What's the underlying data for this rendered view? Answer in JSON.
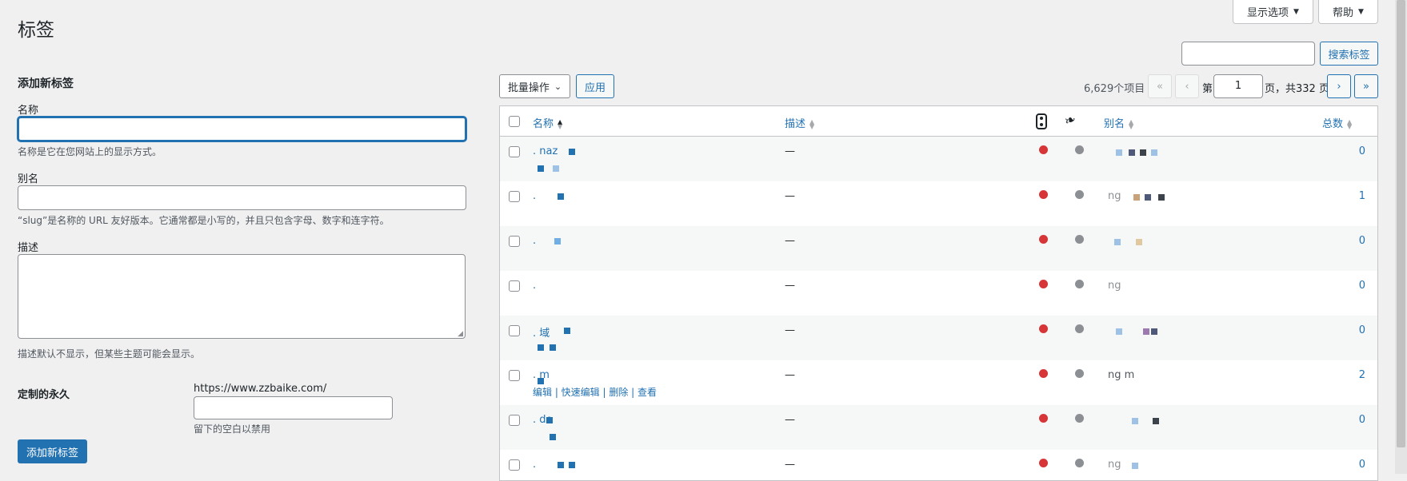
{
  "page_title": "标签",
  "screen_options_label": "显示选项",
  "help_label": "帮助",
  "search": {
    "button_label": "搜索标签",
    "value": ""
  },
  "add_form": {
    "heading": "添加新标签",
    "name_label": "名称",
    "name_value": "",
    "name_hint": "名称是它在您网站上的显示方式。",
    "slug_label": "别名",
    "slug_value": "",
    "slug_hint": "“slug”是名称的 URL 友好版本。它通常都是小写的，并且只包含字母、数字和连字符。",
    "desc_label": "描述",
    "desc_value": "",
    "desc_hint": "描述默认不显示，但某些主题可能会显示。",
    "permalink_label": "定制的永久",
    "permalink_prefix": "https://www.zzbaike.com/",
    "permalink_value": "",
    "permalink_hint": "留下的空白以禁用",
    "submit_label": "添加新标签"
  },
  "toolbar": {
    "bulk_label": "批量操作",
    "apply_label": "应用",
    "item_count": "6,629个项目",
    "first_page": "«",
    "prev_page": "‹",
    "page_prefix": "第",
    "current_page": "1",
    "page_suffix": "页，共332 页",
    "next_page": "›",
    "last_page": "»"
  },
  "table": {
    "columns": {
      "name": "名称",
      "description": "描述",
      "slug": "别名",
      "count": "总数"
    },
    "rows": [
      {
        "name": ".  naz",
        "description": "—",
        "slug": "",
        "count": "0",
        "status_color": "#d63638",
        "seo_color": "#8c8f94"
      },
      {
        "name": ".",
        "description": "—",
        "slug": "ng",
        "count": "1",
        "status_color": "#d63638",
        "seo_color": "#8c8f94"
      },
      {
        "name": ".",
        "description": "—",
        "slug": "",
        "count": "0",
        "status_color": "#d63638",
        "seo_color": "#8c8f94"
      },
      {
        "name": ".",
        "description": "—",
        "slug": "ng",
        "count": "0",
        "status_color": "#d63638",
        "seo_color": "#8c8f94"
      },
      {
        "name": ".   域",
        "description": "—",
        "slug": "",
        "count": "0",
        "status_color": "#d63638",
        "seo_color": "#8c8f94"
      },
      {
        "name": ".   m",
        "description": "—",
        "slug": "ng   m",
        "count": "2",
        "status_color": "#d63638",
        "seo_color": "#8c8f94",
        "row_actions": "编辑 | 快速编辑 | 删除 | 查看"
      },
      {
        "name": ".   de",
        "description": "—",
        "slug": "",
        "count": "0",
        "status_color": "#d63638",
        "seo_color": "#8c8f94"
      },
      {
        "name": ".",
        "description": "—",
        "slug": "ng",
        "count": "0",
        "status_color": "#d63638",
        "seo_color": "#8c8f94"
      }
    ]
  },
  "colors": {
    "accent": "#2271b1",
    "background": "#f0f0f1",
    "error_dot": "#d63638",
    "neutral_dot": "#8c8f94"
  }
}
